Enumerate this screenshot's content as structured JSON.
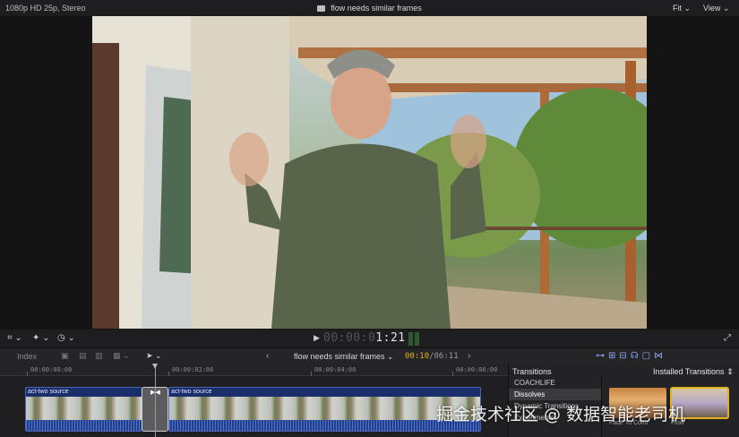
{
  "viewer": {
    "format_info": "1080p HD 25p, Stereo",
    "clip_title": "flow needs similar frames",
    "fit_menu": "Fit",
    "view_menu": "View"
  },
  "transport": {
    "timecode_dim": "00:00:0",
    "timecode_live": "1:21",
    "play_glyph": "▶"
  },
  "timeline_toolbar": {
    "index_label": "Index",
    "project_name": "flow needs similar frames",
    "current_duration": "00:10",
    "separator": "/",
    "total_duration": "06:11"
  },
  "ruler": {
    "ticks": [
      "00:00:00:00",
      "00:00:02:00",
      "00:00:04:00",
      "00:00:06:00"
    ]
  },
  "clips": [
    {
      "label": "act-two source"
    },
    {
      "label": "act-two source"
    }
  ],
  "transitions_browser": {
    "header_left": "Transitions",
    "header_right": "Installed Transitions",
    "categories": [
      "COACHLIFE",
      "Dissolves",
      "Dynamic Transitions",
      "Experiments"
    ],
    "selected_category": "Dissolves",
    "tiles": [
      {
        "name": "Fade To Color"
      },
      {
        "name": "Flow"
      }
    ]
  },
  "watermark_text": "掘金技术社区 @ 数据智能老司机",
  "colors": {
    "accent_yellow": "#e2b21c",
    "clip_blue": "#1a2e6a",
    "tool_blue": "#8fa7ff"
  }
}
